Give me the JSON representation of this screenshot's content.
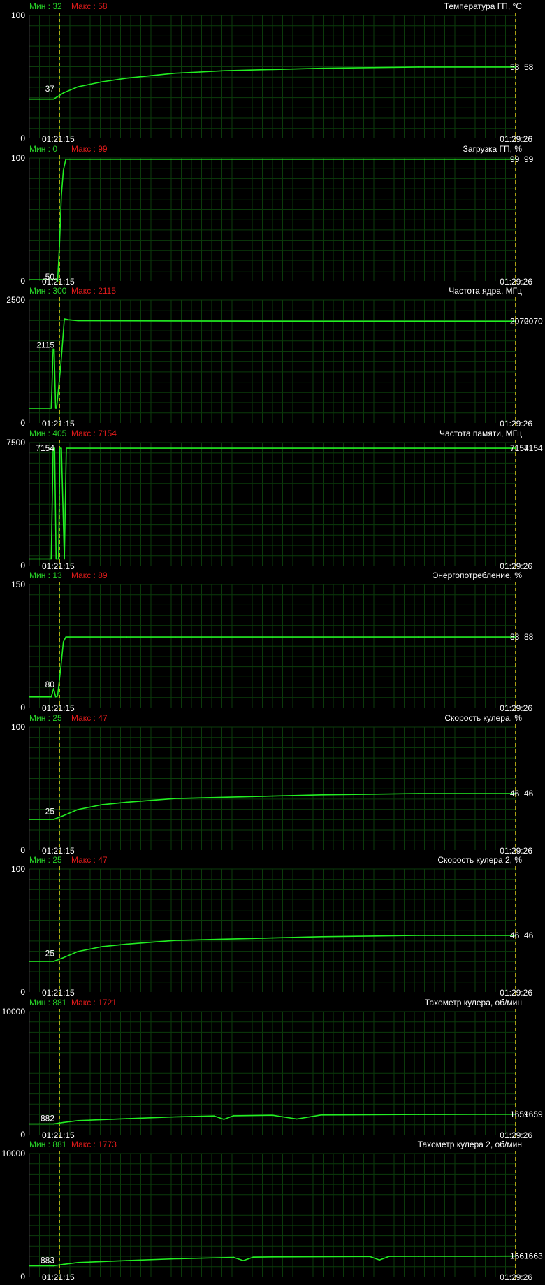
{
  "colors": {
    "background": "#000000",
    "grid": "#0b3b0b",
    "line": "#22ee22",
    "marker": "#e6d21a",
    "min_label": "#27d127",
    "max_label": "#e01b1b",
    "text": "#ffffff"
  },
  "time_start": "01:21:15",
  "time_end": "01:29:26",
  "chart_data": [
    {
      "type": "line",
      "title": "Температура ГП, °C",
      "min_label": "Мин : 32",
      "max_label": "Макс : 58",
      "ylim": [
        0,
        100
      ],
      "ytick_labels": [
        "100",
        "0"
      ],
      "start_label": "37",
      "end_labels": [
        "58",
        "58"
      ],
      "x": [
        0,
        0.05,
        0.07,
        0.1,
        0.15,
        0.2,
        0.25,
        0.3,
        0.35,
        0.4,
        0.5,
        0.6,
        0.7,
        0.8,
        0.9,
        1.0
      ],
      "y": [
        32,
        32,
        37,
        42,
        46,
        49,
        51,
        53,
        54,
        55,
        56,
        57,
        57.5,
        58,
        58,
        58
      ],
      "grid": true
    },
    {
      "type": "line",
      "title": "Загрузка ГП, %",
      "min_label": "Мин : 0",
      "max_label": "Макс : 99",
      "ylim": [
        0,
        100
      ],
      "ytick_labels": [
        "100",
        "0"
      ],
      "start_label": "50",
      "end_labels": [
        "99",
        "99"
      ],
      "x": [
        0,
        0.055,
        0.058,
        0.062,
        0.066,
        0.07,
        0.075,
        1.0
      ],
      "y": [
        1,
        1,
        0,
        30,
        70,
        90,
        99,
        99
      ],
      "grid": true
    },
    {
      "type": "line",
      "title": "Частота ядра, МГц",
      "min_label": "Мин : 300",
      "max_label": "Макс : 2115",
      "ylim": [
        0,
        2500
      ],
      "ytick_labels": [
        "2500",
        "0"
      ],
      "start_label": "2115",
      "end_labels": [
        "2070",
        "2070"
      ],
      "x": [
        0,
        0.045,
        0.049,
        0.051,
        0.054,
        0.056,
        0.065,
        0.072,
        0.076,
        0.08,
        0.1,
        0.3,
        0.6,
        1.0
      ],
      "y": [
        300,
        300,
        1500,
        1500,
        300,
        300,
        1200,
        2115,
        2110,
        2100,
        2080,
        2075,
        2070,
        2070
      ],
      "grid": true
    },
    {
      "type": "line",
      "title": "Частота памяти, МГц",
      "min_label": "Мин : 405",
      "max_label": "Макс : 7154",
      "ylim": [
        0,
        7500
      ],
      "ytick_labels": [
        "7500",
        "0"
      ],
      "start_label": "7154",
      "end_labels": [
        "7154",
        "7154"
      ],
      "x": [
        0,
        0.045,
        0.049,
        0.052,
        0.055,
        0.06,
        0.063,
        0.066,
        0.072,
        0.076,
        1.0
      ],
      "y": [
        405,
        405,
        7154,
        7154,
        405,
        405,
        7154,
        7154,
        405,
        7154,
        7154
      ],
      "grid": true
    },
    {
      "type": "line",
      "title": "Энергопотребление, %",
      "min_label": "Мин : 13",
      "max_label": "Макс : 89",
      "ylim": [
        0,
        150
      ],
      "ytick_labels": [
        "150",
        "0"
      ],
      "start_label": "80",
      "end_labels": [
        "88",
        "88"
      ],
      "x": [
        0,
        0.045,
        0.05,
        0.054,
        0.058,
        0.065,
        0.07,
        0.075,
        0.1,
        0.2,
        0.3,
        0.4,
        0.5,
        0.6,
        0.7,
        0.8,
        0.9,
        1.0
      ],
      "y": [
        13,
        13,
        23,
        13,
        14,
        50,
        80,
        86,
        86,
        86,
        86,
        86,
        86,
        86,
        86,
        86,
        86,
        86
      ],
      "grid": true
    },
    {
      "type": "line",
      "title": "Скорость кулера, %",
      "min_label": "Мин : 25",
      "max_label": "Макс : 47",
      "ylim": [
        0,
        100
      ],
      "ytick_labels": [
        "100",
        "0"
      ],
      "start_label": "25",
      "end_labels": [
        "46",
        "46"
      ],
      "x": [
        0,
        0.05,
        0.07,
        0.1,
        0.15,
        0.2,
        0.3,
        0.4,
        0.5,
        0.6,
        0.7,
        0.8,
        0.9,
        1.0
      ],
      "y": [
        25,
        25,
        28,
        33,
        37,
        39,
        42,
        43,
        44,
        45,
        45.5,
        46,
        46,
        46
      ],
      "grid": true
    },
    {
      "type": "line",
      "title": "Скорость кулера 2, %",
      "min_label": "Мин : 25",
      "max_label": "Макс : 47",
      "ylim": [
        0,
        100
      ],
      "ytick_labels": [
        "100",
        "0"
      ],
      "start_label": "25",
      "end_labels": [
        "46",
        "46"
      ],
      "x": [
        0,
        0.05,
        0.07,
        0.1,
        0.15,
        0.2,
        0.3,
        0.4,
        0.5,
        0.6,
        0.7,
        0.8,
        0.9,
        1.0
      ],
      "y": [
        25,
        25,
        28,
        33,
        37,
        39,
        42,
        43,
        44,
        45,
        45.5,
        46,
        46,
        46
      ],
      "grid": true
    },
    {
      "type": "line",
      "title": "Тахометр кулера, об/мин",
      "min_label": "Мин : 881",
      "max_label": "Макс : 1721",
      "ylim": [
        0,
        10000
      ],
      "ytick_labels": [
        "10000",
        "0"
      ],
      "start_label": "882",
      "end_labels": [
        "1659",
        "1659"
      ],
      "x": [
        0,
        0.05,
        0.07,
        0.1,
        0.2,
        0.3,
        0.38,
        0.4,
        0.42,
        0.5,
        0.55,
        0.6,
        0.7,
        0.8,
        0.9,
        1.0
      ],
      "y": [
        881,
        881,
        1000,
        1150,
        1300,
        1450,
        1520,
        1250,
        1540,
        1580,
        1280,
        1600,
        1620,
        1640,
        1650,
        1659
      ],
      "grid": true
    },
    {
      "type": "line",
      "title": "Тахометр кулера 2, об/мин",
      "min_label": "Мин : 881",
      "max_label": "Макс : 1773",
      "ylim": [
        0,
        10000
      ],
      "ytick_labels": [
        "10000",
        "0"
      ],
      "start_label": "883",
      "end_labels": [
        "1661",
        "1663"
      ],
      "x": [
        0,
        0.05,
        0.07,
        0.1,
        0.2,
        0.3,
        0.42,
        0.44,
        0.46,
        0.5,
        0.7,
        0.72,
        0.74,
        0.8,
        0.9,
        1.0
      ],
      "y": [
        881,
        881,
        1000,
        1150,
        1300,
        1450,
        1560,
        1300,
        1580,
        1600,
        1630,
        1350,
        1640,
        1650,
        1655,
        1663
      ],
      "grid": true
    }
  ]
}
